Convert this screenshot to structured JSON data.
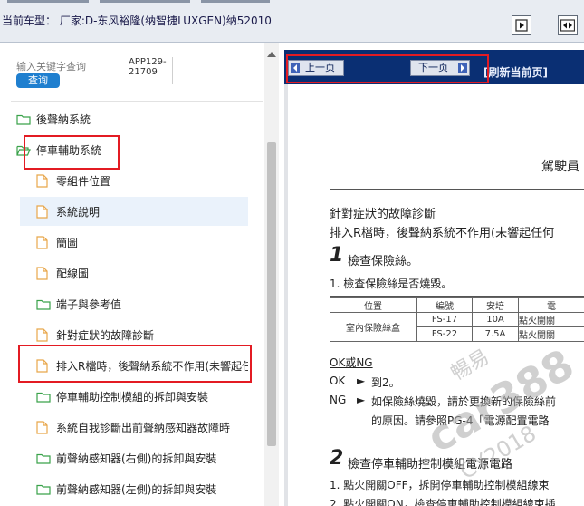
{
  "header": {
    "vehicle_label": "当前车型：  厂家:D-东风裕隆(纳智捷LUXGEN)纳52010",
    "buttons": [
      {
        "name": "expand-right-icon"
      },
      {
        "name": "collapse-both-icon"
      }
    ]
  },
  "search": {
    "placeholder": "输入关键字查询",
    "button_label": "查询"
  },
  "doc_code": "APP129-21709",
  "tree": [
    {
      "label": "後聲納系統",
      "icon": "folder-icon",
      "level": 0
    },
    {
      "label": "停車輔助系統",
      "icon": "folder-open-icon",
      "level": 0
    },
    {
      "label": "零組件位置",
      "icon": "document-icon",
      "level": 1
    },
    {
      "label": "系統說明",
      "icon": "document-icon",
      "level": 1,
      "selected": true
    },
    {
      "label": "簡圖",
      "icon": "document-icon",
      "level": 1
    },
    {
      "label": "配線圖",
      "icon": "document-icon",
      "level": 1
    },
    {
      "label": "端子與參考值",
      "icon": "folder-icon",
      "level": 1
    },
    {
      "label": "針對症狀的故障診斷",
      "icon": "document-icon",
      "level": 1
    },
    {
      "label": "排入R檔時，後聲納系統不作用(未響起任",
      "icon": "document-icon",
      "level": 1
    },
    {
      "label": "停車輔助控制模組的拆卸與安裝",
      "icon": "folder-icon",
      "level": 1
    },
    {
      "label": "系統自我診斷出前聲納感知器故障時",
      "icon": "document-icon",
      "level": 1
    },
    {
      "label": "前聲納感知器(右側)的拆卸與安裝",
      "icon": "folder-icon",
      "level": 1
    },
    {
      "label": "前聲納感知器(左側)的拆卸與安裝",
      "icon": "folder-icon",
      "level": 1
    }
  ],
  "nav": {
    "prev_label": "上一页",
    "next_label": "下一页",
    "refresh_label": "[刷新当前页]"
  },
  "doc": {
    "top_right": "駕駛員",
    "section_title": "針對症狀的故障診斷",
    "symptom": "排入R檔時，後聲納系統不作用(未響起任何",
    "step1_num": "1",
    "step1_title": "檢查保險絲。",
    "step1_item": "1.  檢查保險絲是否燒毀。",
    "table_headers": [
      "位置",
      "編號",
      "安培",
      "電"
    ],
    "table_rows": [
      [
        "室內保險絲盒",
        "FS-17",
        "10A",
        "點火開關"
      ],
      [
        "",
        "FS-22",
        "7.5A",
        "點火開關"
      ]
    ],
    "ok_ng": "OK或NG",
    "ok_label": "OK",
    "ok_text": "到2。",
    "ng_label": "NG",
    "ng_text1": "如保險絲燒毀，請於更換新的保險絲前",
    "ng_text2": "的原因。請參照PG-4「電源配置電路",
    "step2_num": "2",
    "step2_title": "檢查停車輔助控制模組電源電路",
    "step2_item1": "1.  點火開關OFF，拆開停車輔助控制模組線束",
    "step2_item2": "2.  點火開關ON，檢查停車輔助控制模組線束插"
  },
  "watermark": {
    "line1": "暢易",
    "line2": "car388",
    "line3": "CY2018"
  },
  "colors": {
    "nav_bg": "#0a2f73",
    "search_button": "#1f7fcf",
    "highlight_box": "#e31b23"
  }
}
